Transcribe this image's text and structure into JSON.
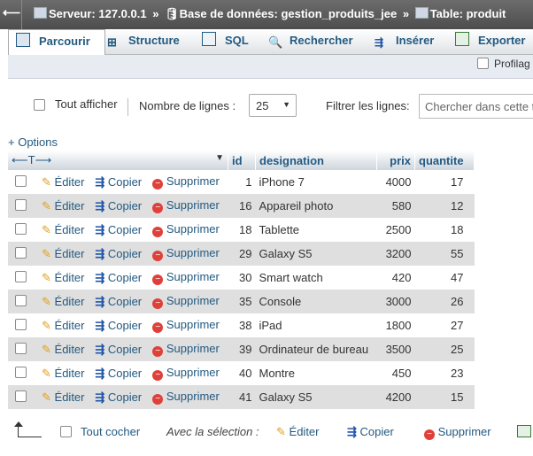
{
  "breadcrumb": {
    "server": "Serveur: 127.0.0.1",
    "database": "Base de données: gestion_produits_jee",
    "table": "Table: produit",
    "separator": "»"
  },
  "tabs": [
    {
      "label": "Parcourir",
      "icon": "table-icon",
      "active": true
    },
    {
      "label": "Structure",
      "icon": "structure-icon",
      "active": false
    },
    {
      "label": "SQL",
      "icon": "sql-icon",
      "active": false
    },
    {
      "label": "Rechercher",
      "icon": "search-icon",
      "active": false
    },
    {
      "label": "Insérer",
      "icon": "insert-icon",
      "active": false
    },
    {
      "label": "Exporter",
      "icon": "export-icon",
      "active": false
    }
  ],
  "subbar": {
    "profiling_label": "Profilag"
  },
  "controls": {
    "show_all_label": "Tout afficher",
    "rows_label": "Nombre de lignes :",
    "rows_value": "25",
    "filter_label": "Filtrer les lignes:",
    "filter_placeholder": "Chercher dans cette t"
  },
  "options_label": "+ Options",
  "table": {
    "columns": [
      "id",
      "designation",
      "prix",
      "quantite"
    ],
    "action_labels": {
      "edit": "Éditer",
      "copy": "Copier",
      "delete": "Supprimer"
    },
    "rows": [
      {
        "id": "1",
        "designation": "iPhone 7",
        "prix": "4000",
        "quantite": "17"
      },
      {
        "id": "16",
        "designation": "Appareil photo",
        "prix": "580",
        "quantite": "12"
      },
      {
        "id": "18",
        "designation": "Tablette",
        "prix": "2500",
        "quantite": "18"
      },
      {
        "id": "29",
        "designation": "Galaxy S5",
        "prix": "3200",
        "quantite": "55"
      },
      {
        "id": "30",
        "designation": "Smart watch",
        "prix": "420",
        "quantite": "47"
      },
      {
        "id": "35",
        "designation": "Console",
        "prix": "3000",
        "quantite": "26"
      },
      {
        "id": "38",
        "designation": "iPad",
        "prix": "1800",
        "quantite": "27"
      },
      {
        "id": "39",
        "designation": "Ordinateur de bureau",
        "prix": "3500",
        "quantite": "25"
      },
      {
        "id": "40",
        "designation": "Montre",
        "prix": "450",
        "quantite": "23"
      },
      {
        "id": "41",
        "designation": "Galaxy S5",
        "prix": "4200",
        "quantite": "15"
      }
    ]
  },
  "bottom": {
    "check_all_label": "Tout cocher",
    "with_selection_label": "Avec la sélection :",
    "edit": "Éditer",
    "copy": "Copier",
    "delete": "Supprimer"
  },
  "colors": {
    "link": "#235a81",
    "row_alt": "#dfdfdf",
    "delete": "#e0403a"
  }
}
